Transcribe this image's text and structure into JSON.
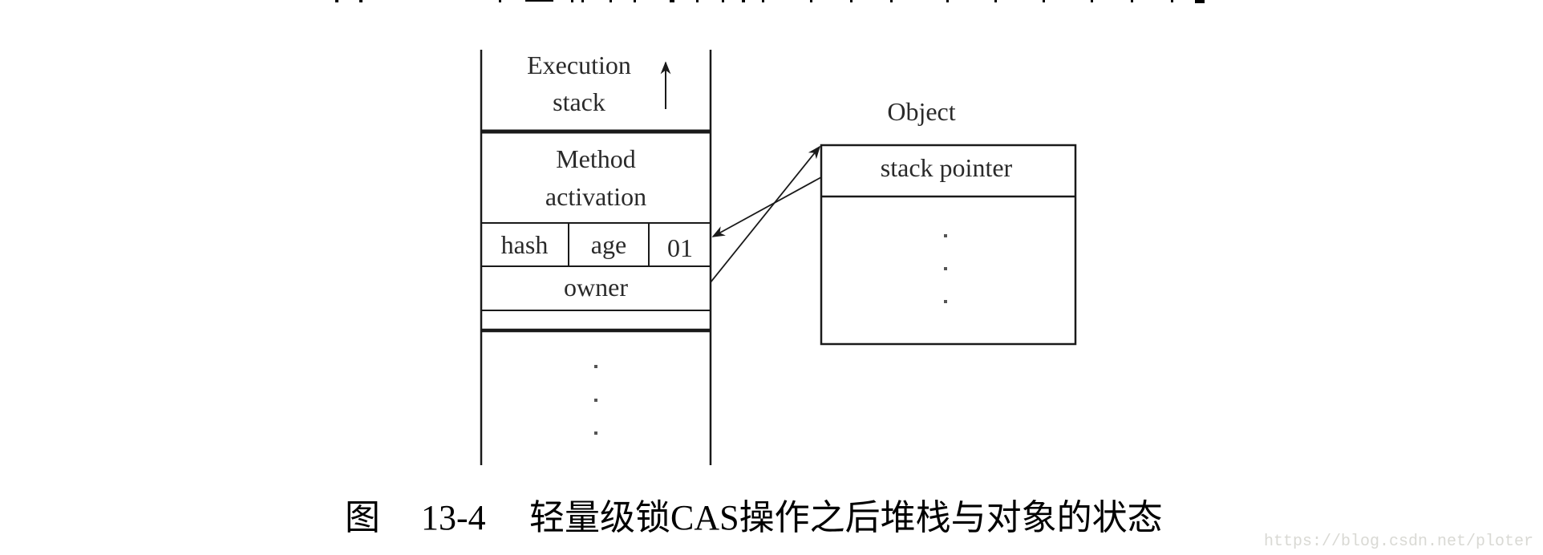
{
  "execution_stack": {
    "title_line1": "Execution",
    "title_line2": "stack",
    "growth_direction_icon": "up-arrow-icon",
    "frame": {
      "label_line1": "Method",
      "label_line2": "activation",
      "mark_word": {
        "hash": "hash",
        "age": "age",
        "lock_bits": "01"
      },
      "owner": "owner"
    },
    "continuation": "⋮"
  },
  "object": {
    "title": "Object",
    "header_field": "stack pointer",
    "continuation": "⋮"
  },
  "relations": [
    {
      "from": "owner",
      "to": "object",
      "label": ""
    },
    {
      "from": "stack pointer",
      "to": "mark_word",
      "label": ""
    }
  ],
  "caption": {
    "prefix": "图",
    "number": "13-4",
    "text": "轻量级锁CAS操作之后堆栈与对象的状态"
  },
  "watermark": "https://blog.csdn.net/ploter",
  "colors": {
    "line": "#1a1a1a",
    "text": "#2a2a2a",
    "watermark": "#d9d9d4"
  }
}
